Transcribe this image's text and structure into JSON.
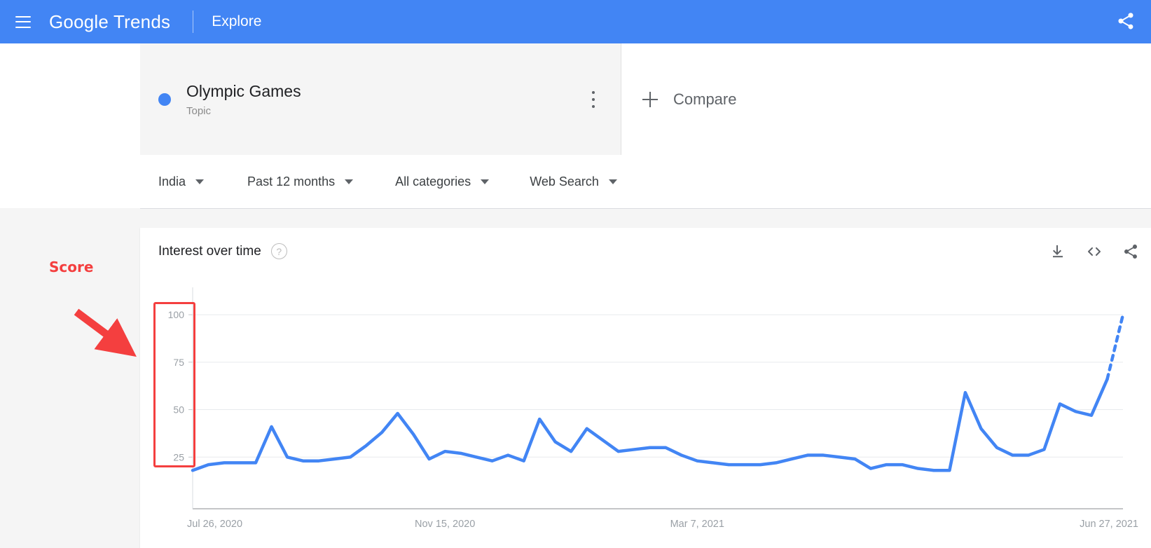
{
  "appbar": {
    "menu_icon": "hamburger-menu-icon",
    "brand_google": "Google",
    "brand_trends": "Trends",
    "explore": "Explore",
    "share_icon": "share-icon",
    "bg_color": "#4285F4"
  },
  "term": {
    "dot_color": "#4285F4",
    "title": "Olympic Games",
    "subtitle": "Topic",
    "menu_icon": "more-options-icon",
    "compare_label": "Compare",
    "compare_icon": "plus-icon"
  },
  "filters": [
    {
      "label": "India"
    },
    {
      "label": "Past 12 months"
    },
    {
      "label": "All categories"
    },
    {
      "label": "Web Search"
    }
  ],
  "chart_card": {
    "title": "Interest over time",
    "help_icon": "help-circle-icon",
    "actions": [
      {
        "name": "download-icon"
      },
      {
        "name": "embed-code-icon"
      },
      {
        "name": "share-icon"
      }
    ]
  },
  "annotations": {
    "score_label": "Score",
    "color": "#F43F3F",
    "arrow": "down-right-arrow",
    "highlight": "y-axis-score-box"
  },
  "chart_data": {
    "type": "line",
    "title": "Interest over time",
    "xlabel": "",
    "ylabel": "",
    "ylim": [
      0,
      110
    ],
    "yticks": [
      25,
      50,
      75,
      100
    ],
    "ytick_labels": [
      "25",
      "50",
      "75",
      "100"
    ],
    "grid": true,
    "legend_position": "none",
    "line_color": "#4285F4",
    "forecast_style": "dotted",
    "xtick_labels": [
      "Jul 26, 2020",
      "Nov 15, 2020",
      "Mar 7, 2021",
      "Jun 27, 2021"
    ],
    "xtick_positions": [
      0,
      16,
      32,
      48
    ],
    "series": [
      {
        "name": "Olympic Games",
        "values": [
          18,
          21,
          22,
          22,
          22,
          41,
          25,
          23,
          23,
          24,
          25,
          31,
          38,
          48,
          37,
          24,
          28,
          27,
          25,
          23,
          26,
          23,
          45,
          33,
          28,
          40,
          34,
          28,
          29,
          30,
          30,
          26,
          23,
          22,
          21,
          21,
          21,
          22,
          24,
          26,
          26,
          25,
          24,
          19,
          21,
          21,
          19,
          18,
          18,
          59,
          40,
          30,
          26,
          26,
          29,
          53,
          49,
          47,
          66,
          100
        ],
        "forecast_from_index": 58
      }
    ]
  }
}
